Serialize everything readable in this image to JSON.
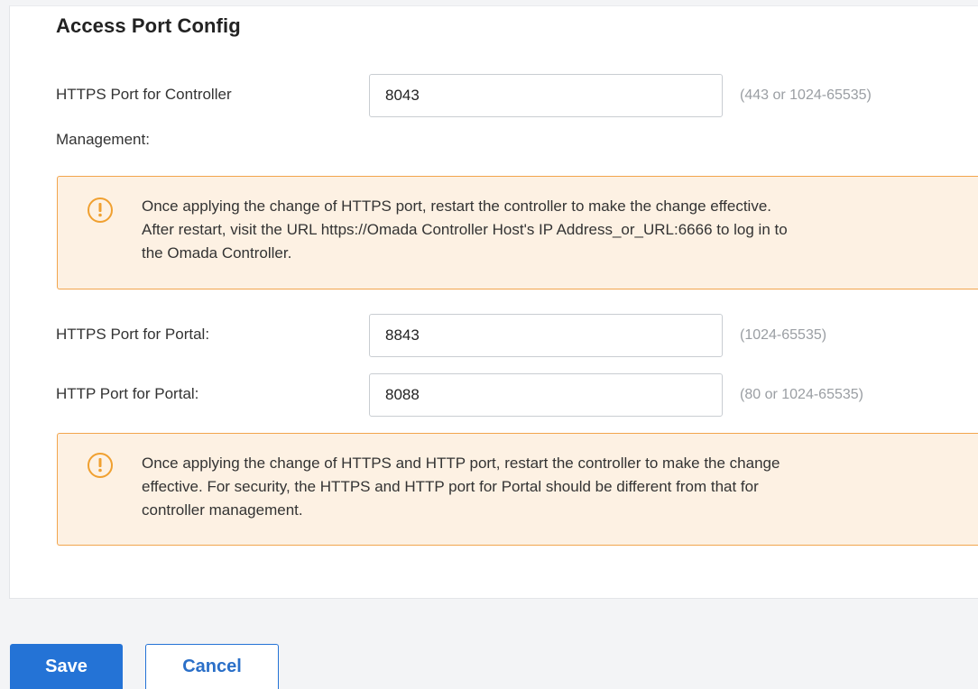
{
  "section": {
    "title": "Access Port Config"
  },
  "fields": {
    "controller_https": {
      "label_line1": "HTTPS Port for Controller",
      "label_line2": "Management:",
      "value": "8043",
      "hint": "(443 or 1024-65535)"
    },
    "portal_https": {
      "label": "HTTPS Port for Portal:",
      "value": "8843",
      "hint": "(1024-65535)"
    },
    "portal_http": {
      "label": "HTTP Port for Portal:",
      "value": "8088",
      "hint": "(80 or 1024-65535)"
    }
  },
  "notices": {
    "controller": {
      "line1": "Once applying the change of HTTPS port, restart the controller to make the change effective.",
      "line2": "After restart, visit the URL https://Omada Controller Host's IP Address_or_URL:6666 to log in to",
      "line3": "the Omada Controller.",
      "icon": "exclamation-circle-icon"
    },
    "portal": {
      "line1": "Once applying the change of HTTPS and HTTP port, restart the controller to make the change",
      "line2": "effective. For security, the HTTPS and HTTP port for Portal should be different from that for",
      "line3": "controller management.",
      "icon": "exclamation-circle-icon"
    }
  },
  "actions": {
    "save_label": "Save",
    "cancel_label": "Cancel"
  },
  "colors": {
    "primary": "#2473d6",
    "notice_border": "#f2a54d",
    "notice_background": "#fdf1e3",
    "notice_icon": "#f0a030",
    "hint_text": "#9a9ea3"
  }
}
